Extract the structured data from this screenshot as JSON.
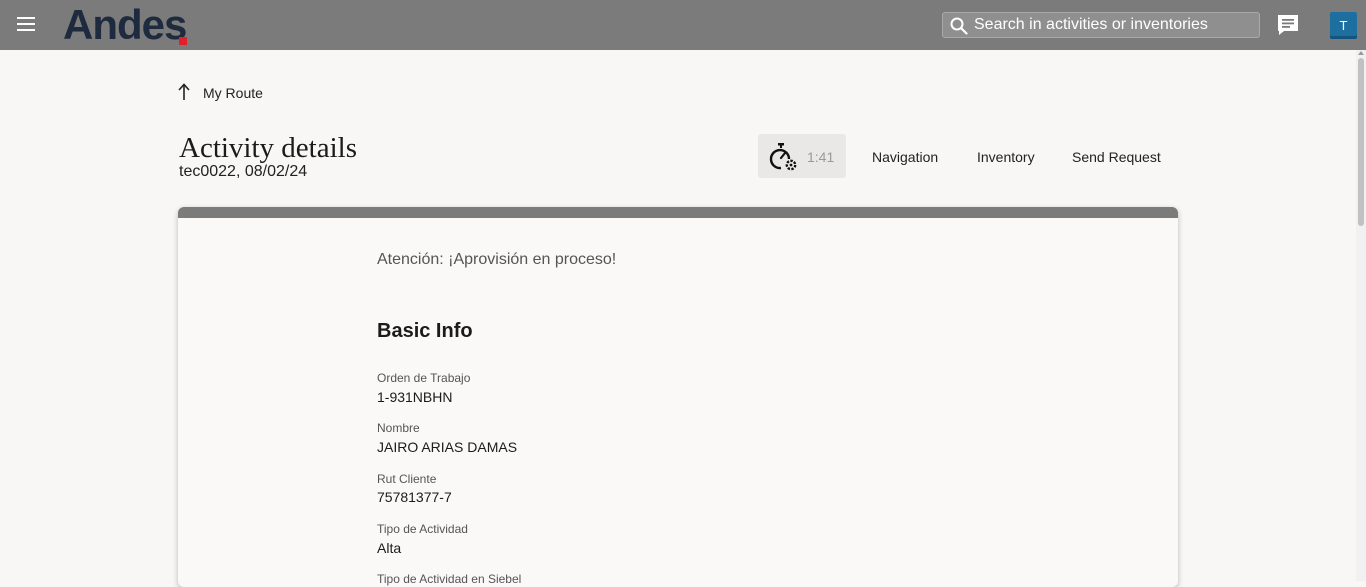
{
  "header": {
    "logo_text": "Andes",
    "search_placeholder": "Search in activities or inventories",
    "avatar_initial": "T"
  },
  "nav": {
    "back_label": "My Route"
  },
  "page": {
    "title": "Activity details",
    "subtitle": "tec0022, 08/02/24"
  },
  "toolbar": {
    "timer_value": "1:41",
    "navigation_label": "Navigation",
    "inventory_label": "Inventory",
    "send_request_label": "Send Request"
  },
  "card": {
    "notice": "Atención: ¡Aprovisión en proceso!",
    "section_title": "Basic Info",
    "fields": [
      {
        "label": "Orden de Trabajo",
        "value": "1-931NBHN"
      },
      {
        "label": "Nombre",
        "value": "JAIRO ARIAS DAMAS"
      },
      {
        "label": "Rut Cliente",
        "value": "75781377-7"
      },
      {
        "label": "Tipo de Actividad",
        "value": "Alta"
      },
      {
        "label": "Tipo de Actividad en Siebel",
        "value": ""
      }
    ]
  },
  "colors": {
    "header_bg": "#7b7b7b",
    "logo_dark": "#1e2a3d",
    "logo_accent": "#e0202a",
    "avatar_bg": "#1d6fa0"
  },
  "icons": [
    "menu-icon",
    "search-icon",
    "chat-icon",
    "arrow-up-icon",
    "timer-gear-icon"
  ]
}
